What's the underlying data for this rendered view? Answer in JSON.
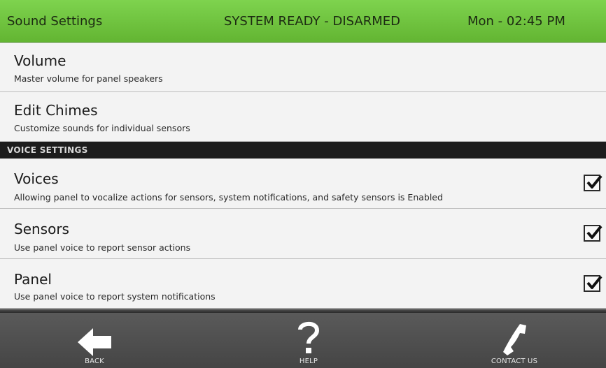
{
  "header": {
    "title": "Sound Settings",
    "status": "SYSTEM READY - DISARMED",
    "datetime": "Mon - 02:45 PM"
  },
  "items": [
    {
      "title": "Volume",
      "subtitle": "Master volume for panel speakers"
    },
    {
      "title": "Edit Chimes",
      "subtitle": "Customize sounds for individual sensors"
    }
  ],
  "voice_section": {
    "header": "VOICE SETTINGS",
    "items": [
      {
        "title": "Voices",
        "subtitle": "Allowing panel to vocalize actions for sensors, system notifications, and safety sensors is Enabled",
        "checked": true
      },
      {
        "title": "Sensors",
        "subtitle": "Use panel voice to report sensor actions",
        "checked": true
      },
      {
        "title": "Panel",
        "subtitle": "Use panel voice to report system notifications",
        "checked": true
      }
    ]
  },
  "footer": {
    "back_label": "BACK",
    "help_label": "HELP",
    "contact_label": "CONTACT US",
    "back_icon": "left-arrow-icon",
    "help_icon": "question-mark-icon",
    "contact_icon": "phone-icon"
  },
  "colors": {
    "header_green": "#6cc23c",
    "section_header": "#1c1c1c",
    "footer": "#4d4d4d"
  }
}
